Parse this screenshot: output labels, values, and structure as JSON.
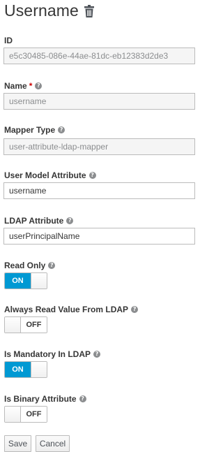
{
  "page": {
    "title": "Username",
    "icon": "trash-icon"
  },
  "fields": {
    "id": {
      "label": "ID",
      "value": "e5c30485-086e-44ae-81dc-eb12383d2de3"
    },
    "name": {
      "label": "Name",
      "required_mark": "*",
      "value": "username"
    },
    "mapper_type": {
      "label": "Mapper Type",
      "value": "user-attribute-ldap-mapper"
    },
    "user_model_attribute": {
      "label": "User Model Attribute",
      "value": "username"
    },
    "ldap_attribute": {
      "label": "LDAP Attribute",
      "value": "userPrincipalName"
    }
  },
  "toggles": {
    "read_only": {
      "label": "Read Only",
      "state": "ON"
    },
    "always_read": {
      "label": "Always Read Value From LDAP",
      "state": "OFF"
    },
    "mandatory": {
      "label": "Is Mandatory In LDAP",
      "state": "ON"
    },
    "binary": {
      "label": "Is Binary Attribute",
      "state": "OFF"
    }
  },
  "help_icon": "question-circle-icon",
  "actions": {
    "save": "Save",
    "cancel": "Cancel"
  },
  "colors": {
    "accent": "#0099d3",
    "required": "#cc0000",
    "text": "#363636",
    "muted": "#8b8d8f"
  }
}
